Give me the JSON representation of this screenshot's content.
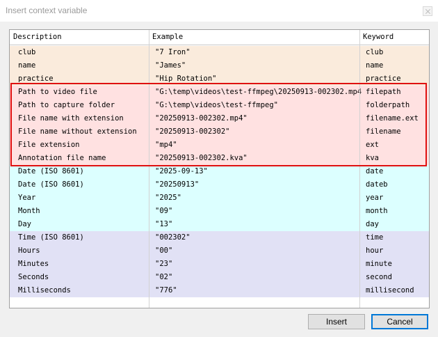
{
  "window": {
    "title": "Insert context variable"
  },
  "table": {
    "columns": [
      "Description",
      "Example",
      "Keyword"
    ],
    "rows": [
      {
        "description": "club",
        "example": "\"7 Iron\"",
        "keyword": "club",
        "group": "custom"
      },
      {
        "description": "name",
        "example": "\"James\"",
        "keyword": "name",
        "group": "custom"
      },
      {
        "description": "practice",
        "example": "\"Hip Rotation\"",
        "keyword": "practice",
        "group": "custom"
      },
      {
        "description": "Path to video file",
        "example": "\"G:\\temp\\videos\\test-ffmpeg\\20250913-002302.mp4\"",
        "keyword": "filepath",
        "group": "file"
      },
      {
        "description": "Path to capture folder",
        "example": "\"G:\\temp\\videos\\test-ffmpeg\"",
        "keyword": "folderpath",
        "group": "file"
      },
      {
        "description": "File name with extension",
        "example": "\"20250913-002302.mp4\"",
        "keyword": "filename.ext",
        "group": "file"
      },
      {
        "description": "File name without extension",
        "example": "\"20250913-002302\"",
        "keyword": "filename",
        "group": "file"
      },
      {
        "description": "File extension",
        "example": "\"mp4\"",
        "keyword": "ext",
        "group": "file"
      },
      {
        "description": "Annotation file name",
        "example": "\"20250913-002302.kva\"",
        "keyword": "kva",
        "group": "file"
      },
      {
        "description": "Date (ISO 8601)",
        "example": "\"2025-09-13\"",
        "keyword": "date",
        "group": "date"
      },
      {
        "description": "Date (ISO 8601)",
        "example": "\"20250913\"",
        "keyword": "dateb",
        "group": "date"
      },
      {
        "description": "Year",
        "example": "\"2025\"",
        "keyword": "year",
        "group": "date"
      },
      {
        "description": "Month",
        "example": "\"09\"",
        "keyword": "month",
        "group": "date"
      },
      {
        "description": "Day",
        "example": "\"13\"",
        "keyword": "day",
        "group": "date"
      },
      {
        "description": "Time (ISO 8601)",
        "example": "\"002302\"",
        "keyword": "time",
        "group": "time"
      },
      {
        "description": "Hours",
        "example": "\"00\"",
        "keyword": "hour",
        "group": "time"
      },
      {
        "description": "Minutes",
        "example": "\"23\"",
        "keyword": "minute",
        "group": "time"
      },
      {
        "description": "Seconds",
        "example": "\"02\"",
        "keyword": "second",
        "group": "time"
      },
      {
        "description": "Milliseconds",
        "example": "\"776\"",
        "keyword": "millisecond",
        "group": "time"
      }
    ],
    "group_colors": {
      "custom": "#faebdc",
      "file": "#ffe1e1",
      "date": "#dcffff",
      "time": "#e1e1f5"
    },
    "highlight_color": "#e01010"
  },
  "buttons": {
    "insert": "Insert",
    "cancel": "Cancel"
  },
  "icons": {
    "close": "close-icon"
  }
}
